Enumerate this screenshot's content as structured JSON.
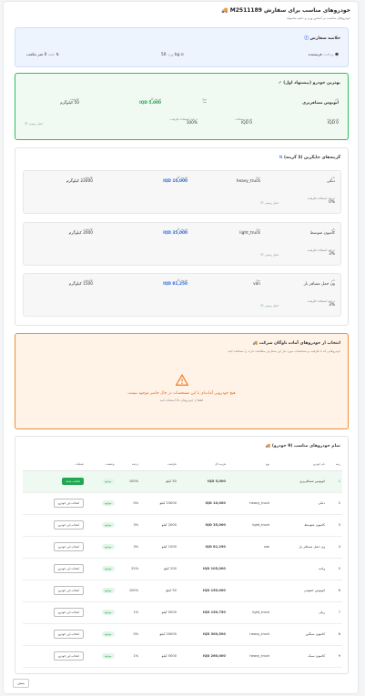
{
  "header": {
    "title": "خودروهای مناسب برای سفارش M2511189",
    "subtitle": "خودروهای مناسب بر اساس وزن و حجم محموله"
  },
  "summary": {
    "title": "خلاصه سفارش",
    "weight_label": "وزن:",
    "weight_value": "50 kg",
    "volume_label": "حجم:",
    "volume_value": "0 متر مکعب",
    "payer_label": "پرداخت:",
    "payer_value": "فرستنده"
  },
  "best": {
    "title": "بهترین خودرو (پیشنهاد اول)",
    "name_label": "نام",
    "name_value": "اتوبوس مسافربری",
    "type_label": "نوع",
    "type_value": "—",
    "price_label": "هزینه کل",
    "price_value": "IQD 5,000",
    "capacity_label": "ظرفیت",
    "capacity_value": "50 کیلوگرم",
    "extra_label": "هزینه مسافت",
    "extra_value": "IQD 0",
    "base_label": "هزینه پایه",
    "base_value": "IQD 0",
    "util_label": "درصد استفاده ظرفیت",
    "util_value": "100%",
    "tag": "حمل زمینی"
  },
  "routes": {
    "title": "گزینه‌های جایگزین (3 گزینه)",
    "items": [
      {
        "name": "دنکی",
        "type": "heavy_truck",
        "price": "IQD 10,000",
        "capacity": "23000 کیلوگرم",
        "util": "0%",
        "tag": "حمل زمینی"
      },
      {
        "name": "کامیون متوسط",
        "type": "light_truck",
        "price": "IQD 35,000",
        "capacity": "2000 کیلوگرم",
        "util": "3%",
        "tag": "حمل زمینی"
      },
      {
        "name": "ون حمل مسافر بار",
        "type": "van",
        "price": "IQD 81,250",
        "capacity": "1500 کیلوگرم",
        "util": "3%",
        "tag": "حمل زمینی"
      }
    ],
    "name_label": "نام",
    "type_label": "نوع",
    "price_label": "هزینه کل",
    "capacity_label": "ظرفیت",
    "util_label": "درصد استفاده ظرفیت"
  },
  "company": {
    "title": "انتخاب از خودروهای آماده ناوگان شرکت",
    "desc": "خودروهایی که با ظرفیت و مشخصات مورد نیاز این سفارش مطابقت دارند را مشاهده کنید.",
    "warn_title": "هیچ خودرویی آماده‌ای با این مشخصات در حال حاضر موجود نیست",
    "warn_sub": "لطفا از خودروهای بالا استفاده کنید"
  },
  "table": {
    "title": "تمام خودروهای مناسب (9 خودرو)",
    "headers": [
      "رتبه",
      "نام خودرو",
      "نوع",
      "هزینه کل",
      "ظرفیت",
      "درصد",
      "وضعیت",
      "عملیات"
    ],
    "select_label": "انتخاب شده",
    "choose_label": "انتخاب این خودرو",
    "rows": [
      {
        "rank": "1",
        "name": "اتوبوس مسافربری",
        "type": "",
        "price": "IQD 5,000",
        "capacity": "50 کیلو",
        "util": "100%",
        "status": "موجود",
        "best": true
      },
      {
        "rank": "2",
        "name": "دنکی",
        "type": "heavy_truck",
        "price": "IQD 10,000",
        "capacity": "23000 کیلو",
        "util": "0%",
        "status": "موجود",
        "best": false
      },
      {
        "rank": "3",
        "name": "کامیون متوسط",
        "type": "light_truck",
        "price": "IQD 35,000",
        "capacity": "2000 کیلو",
        "util": "3%",
        "status": "موجود",
        "best": false
      },
      {
        "rank": "4",
        "name": "ون حمل مسافر بار",
        "type": "van",
        "price": "IQD 81,250",
        "capacity": "1500 کیلو",
        "util": "3%",
        "status": "موجود",
        "best": false
      },
      {
        "rank": "5",
        "name": "وانت",
        "type": "",
        "price": "IQD 105,000",
        "capacity": "200 کیلو",
        "util": "25%",
        "status": "موجود",
        "best": false
      },
      {
        "rank": "6",
        "name": "اتوبوس حمومی",
        "type": "",
        "price": "IQD 150,000",
        "capacity": "50 کیلو",
        "util": "100%",
        "status": "موجود",
        "best": false
      },
      {
        "rank": "7",
        "name": "ریلی",
        "type": "light_truck",
        "price": "IQD 150,750",
        "capacity": "5000 کیلو",
        "util": "1%",
        "status": "موجود",
        "best": false
      },
      {
        "rank": "8",
        "name": "کامیون سنگین",
        "type": "heavy_truck",
        "price": "IQD 300,500",
        "capacity": "20000 کیلو",
        "util": "0%",
        "status": "موجود",
        "best": false
      },
      {
        "rank": "9",
        "name": "کامیون سبک",
        "type": "heavy_truck",
        "price": "IQD 260,000",
        "capacity": "5000 کیلو",
        "util": "1%",
        "status": "موجود",
        "best": false
      }
    ]
  },
  "footer": {
    "back_label": "بستن"
  }
}
